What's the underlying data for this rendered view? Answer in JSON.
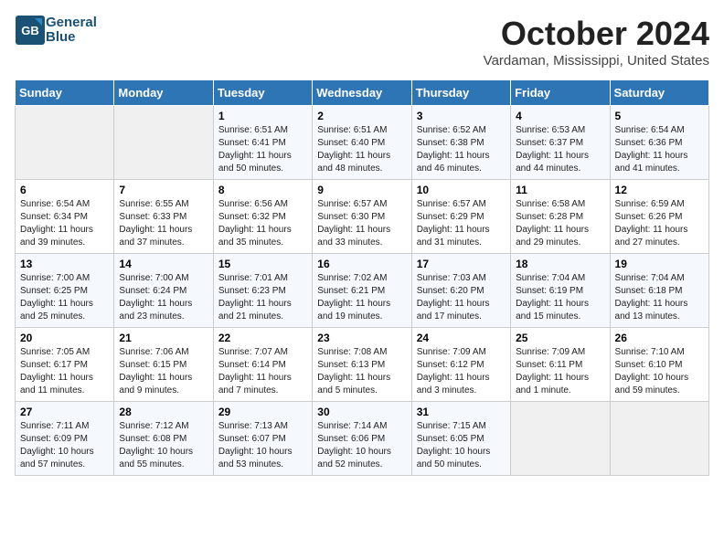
{
  "header": {
    "logo_line1": "General",
    "logo_line2": "Blue",
    "month": "October 2024",
    "location": "Vardaman, Mississippi, United States"
  },
  "days_of_week": [
    "Sunday",
    "Monday",
    "Tuesday",
    "Wednesday",
    "Thursday",
    "Friday",
    "Saturday"
  ],
  "weeks": [
    [
      {
        "day": "",
        "info": ""
      },
      {
        "day": "",
        "info": ""
      },
      {
        "day": "1",
        "info": "Sunrise: 6:51 AM\nSunset: 6:41 PM\nDaylight: 11 hours and 50 minutes."
      },
      {
        "day": "2",
        "info": "Sunrise: 6:51 AM\nSunset: 6:40 PM\nDaylight: 11 hours and 48 minutes."
      },
      {
        "day": "3",
        "info": "Sunrise: 6:52 AM\nSunset: 6:38 PM\nDaylight: 11 hours and 46 minutes."
      },
      {
        "day": "4",
        "info": "Sunrise: 6:53 AM\nSunset: 6:37 PM\nDaylight: 11 hours and 44 minutes."
      },
      {
        "day": "5",
        "info": "Sunrise: 6:54 AM\nSunset: 6:36 PM\nDaylight: 11 hours and 41 minutes."
      }
    ],
    [
      {
        "day": "6",
        "info": "Sunrise: 6:54 AM\nSunset: 6:34 PM\nDaylight: 11 hours and 39 minutes."
      },
      {
        "day": "7",
        "info": "Sunrise: 6:55 AM\nSunset: 6:33 PM\nDaylight: 11 hours and 37 minutes."
      },
      {
        "day": "8",
        "info": "Sunrise: 6:56 AM\nSunset: 6:32 PM\nDaylight: 11 hours and 35 minutes."
      },
      {
        "day": "9",
        "info": "Sunrise: 6:57 AM\nSunset: 6:30 PM\nDaylight: 11 hours and 33 minutes."
      },
      {
        "day": "10",
        "info": "Sunrise: 6:57 AM\nSunset: 6:29 PM\nDaylight: 11 hours and 31 minutes."
      },
      {
        "day": "11",
        "info": "Sunrise: 6:58 AM\nSunset: 6:28 PM\nDaylight: 11 hours and 29 minutes."
      },
      {
        "day": "12",
        "info": "Sunrise: 6:59 AM\nSunset: 6:26 PM\nDaylight: 11 hours and 27 minutes."
      }
    ],
    [
      {
        "day": "13",
        "info": "Sunrise: 7:00 AM\nSunset: 6:25 PM\nDaylight: 11 hours and 25 minutes."
      },
      {
        "day": "14",
        "info": "Sunrise: 7:00 AM\nSunset: 6:24 PM\nDaylight: 11 hours and 23 minutes."
      },
      {
        "day": "15",
        "info": "Sunrise: 7:01 AM\nSunset: 6:23 PM\nDaylight: 11 hours and 21 minutes."
      },
      {
        "day": "16",
        "info": "Sunrise: 7:02 AM\nSunset: 6:21 PM\nDaylight: 11 hours and 19 minutes."
      },
      {
        "day": "17",
        "info": "Sunrise: 7:03 AM\nSunset: 6:20 PM\nDaylight: 11 hours and 17 minutes."
      },
      {
        "day": "18",
        "info": "Sunrise: 7:04 AM\nSunset: 6:19 PM\nDaylight: 11 hours and 15 minutes."
      },
      {
        "day": "19",
        "info": "Sunrise: 7:04 AM\nSunset: 6:18 PM\nDaylight: 11 hours and 13 minutes."
      }
    ],
    [
      {
        "day": "20",
        "info": "Sunrise: 7:05 AM\nSunset: 6:17 PM\nDaylight: 11 hours and 11 minutes."
      },
      {
        "day": "21",
        "info": "Sunrise: 7:06 AM\nSunset: 6:15 PM\nDaylight: 11 hours and 9 minutes."
      },
      {
        "day": "22",
        "info": "Sunrise: 7:07 AM\nSunset: 6:14 PM\nDaylight: 11 hours and 7 minutes."
      },
      {
        "day": "23",
        "info": "Sunrise: 7:08 AM\nSunset: 6:13 PM\nDaylight: 11 hours and 5 minutes."
      },
      {
        "day": "24",
        "info": "Sunrise: 7:09 AM\nSunset: 6:12 PM\nDaylight: 11 hours and 3 minutes."
      },
      {
        "day": "25",
        "info": "Sunrise: 7:09 AM\nSunset: 6:11 PM\nDaylight: 11 hours and 1 minute."
      },
      {
        "day": "26",
        "info": "Sunrise: 7:10 AM\nSunset: 6:10 PM\nDaylight: 10 hours and 59 minutes."
      }
    ],
    [
      {
        "day": "27",
        "info": "Sunrise: 7:11 AM\nSunset: 6:09 PM\nDaylight: 10 hours and 57 minutes."
      },
      {
        "day": "28",
        "info": "Sunrise: 7:12 AM\nSunset: 6:08 PM\nDaylight: 10 hours and 55 minutes."
      },
      {
        "day": "29",
        "info": "Sunrise: 7:13 AM\nSunset: 6:07 PM\nDaylight: 10 hours and 53 minutes."
      },
      {
        "day": "30",
        "info": "Sunrise: 7:14 AM\nSunset: 6:06 PM\nDaylight: 10 hours and 52 minutes."
      },
      {
        "day": "31",
        "info": "Sunrise: 7:15 AM\nSunset: 6:05 PM\nDaylight: 10 hours and 50 minutes."
      },
      {
        "day": "",
        "info": ""
      },
      {
        "day": "",
        "info": ""
      }
    ]
  ]
}
